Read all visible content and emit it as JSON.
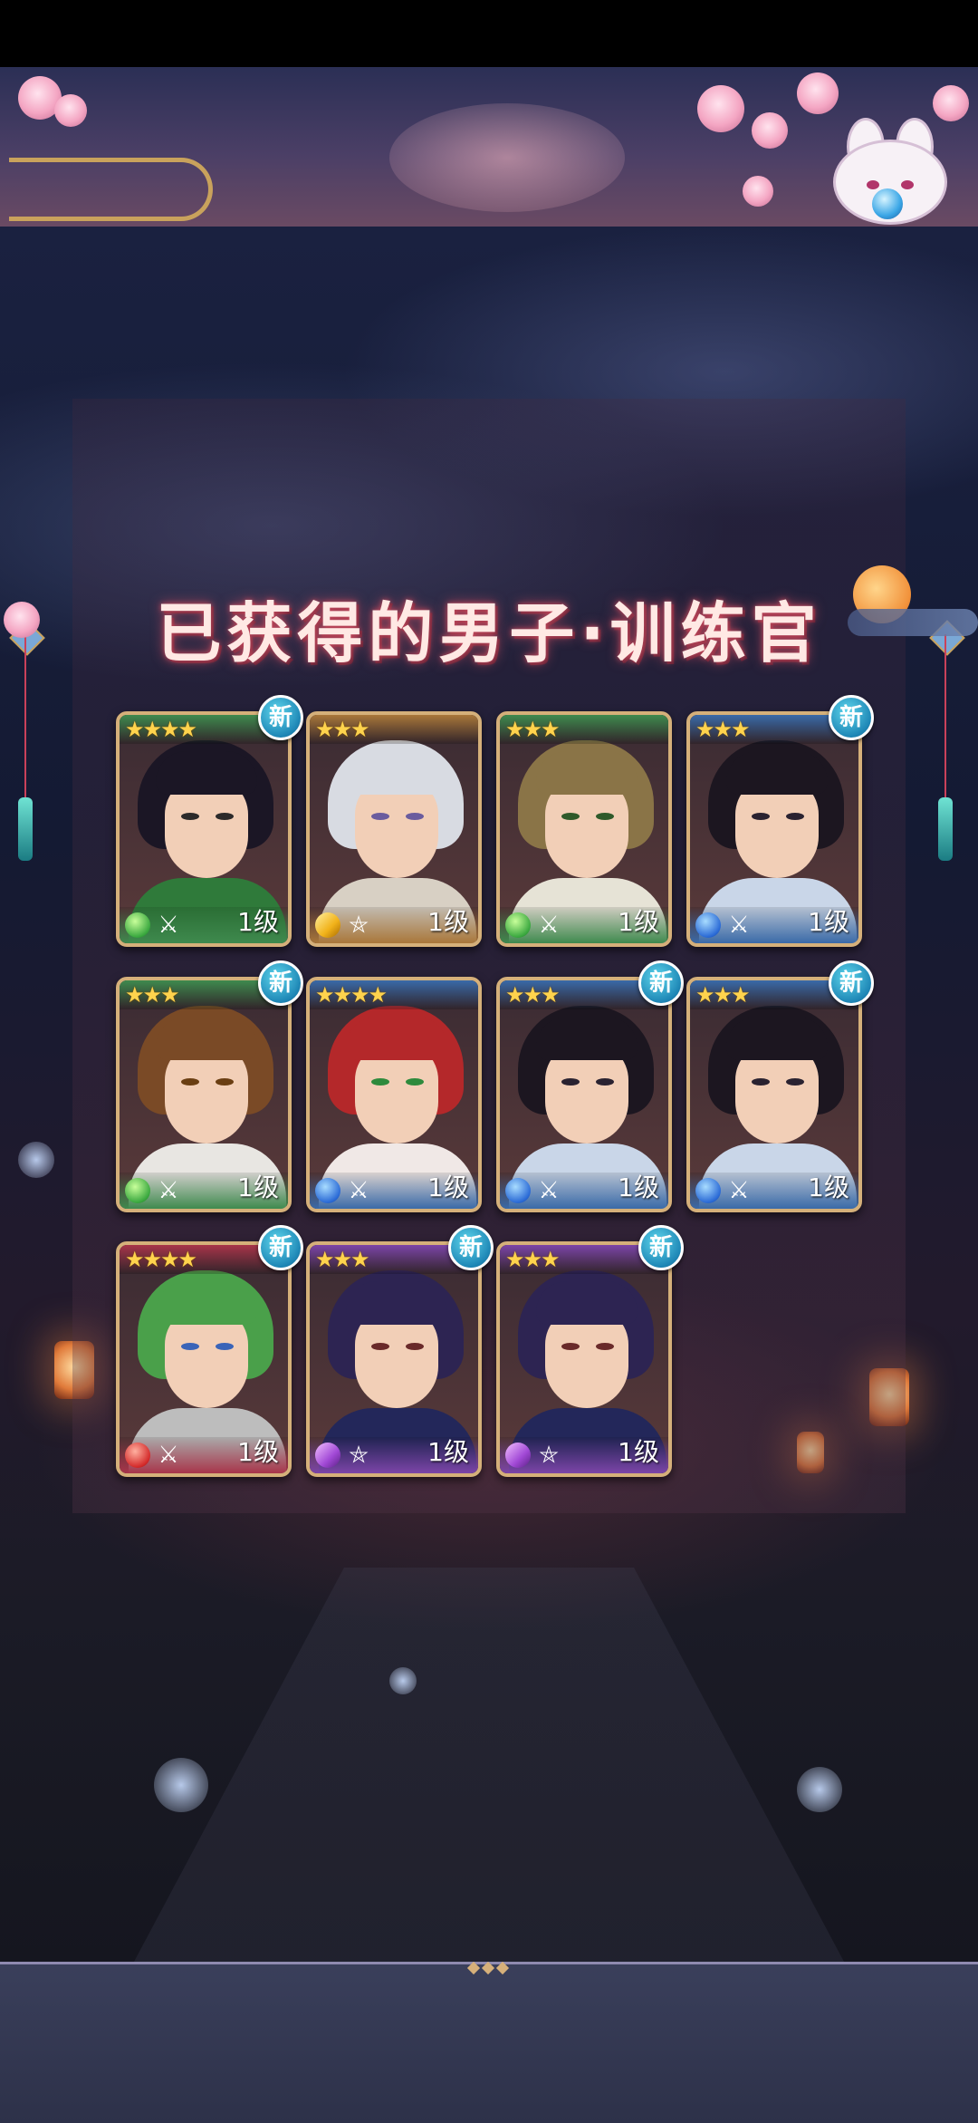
{
  "panel": {
    "title": "已获得的男子·训练官"
  },
  "new_badge_label": "新",
  "colors": {
    "accent_gold": "#d5b07a",
    "new_badge": "#1e87b6",
    "title_glow": "#c2475b"
  },
  "cards": [
    {
      "stars": "★★★★",
      "level": "1级",
      "is_new": true,
      "element_icon": "leaf-icon",
      "weapon_icon": "crossed-swords-icon",
      "band": "#3f8a4e",
      "hair": "#1b1625",
      "outfit": "#2f7a3a",
      "eyes": "#2c2a2a"
    },
    {
      "stars": "★★★",
      "level": "1级",
      "is_new": false,
      "element_icon": "diamond-icon",
      "weapon_icon": "pentagram-icon",
      "band": "#a9773a",
      "hair": "#d8dbe2",
      "outfit": "#d8d0c4",
      "eyes": "#6a5c9e"
    },
    {
      "stars": "★★★",
      "level": "1级",
      "is_new": false,
      "element_icon": "leaf-icon",
      "weapon_icon": "crossed-swords-icon",
      "band": "#3f8a4e",
      "hair": "#8a7447",
      "outfit": "#e6e3d6",
      "eyes": "#2f5a2a"
    },
    {
      "stars": "★★★",
      "level": "1级",
      "is_new": true,
      "element_icon": "water-icon",
      "weapon_icon": "crossed-swords-icon",
      "band": "#3a6aa8",
      "hair": "#1c1620",
      "outfit": "#c9d6e8",
      "eyes": "#2a2230"
    },
    {
      "stars": "★★★",
      "level": "1级",
      "is_new": true,
      "element_icon": "leaf-icon",
      "weapon_icon": "crossed-swords-icon",
      "band": "#3f8a4e",
      "hair": "#7a4a26",
      "outfit": "#e8e6e2",
      "eyes": "#6a3e12"
    },
    {
      "stars": "★★★★",
      "level": "1级",
      "is_new": false,
      "element_icon": "water-icon",
      "weapon_icon": "crossed-swords-icon",
      "band": "#3a6aa8",
      "hair": "#b4282a",
      "outfit": "#f0e8e6",
      "eyes": "#2e8a3c"
    },
    {
      "stars": "★★★",
      "level": "1级",
      "is_new": true,
      "element_icon": "water-icon",
      "weapon_icon": "crossed-swords-icon",
      "band": "#3a6aa8",
      "hair": "#1c1620",
      "outfit": "#c9d6e8",
      "eyes": "#2a2230"
    },
    {
      "stars": "★★★",
      "level": "1级",
      "is_new": true,
      "element_icon": "water-icon",
      "weapon_icon": "crossed-swords-icon",
      "band": "#3a6aa8",
      "hair": "#1c1620",
      "outfit": "#c9d6e8",
      "eyes": "#2a2230"
    },
    {
      "stars": "★★★★",
      "level": "1级",
      "is_new": true,
      "element_icon": "fire-icon",
      "weapon_icon": "crossed-swords-icon",
      "band": "#a8354a",
      "hair": "#4aa04a",
      "outfit": "#bdbdbd",
      "eyes": "#3a64b8"
    },
    {
      "stars": "★★★",
      "level": "1级",
      "is_new": true,
      "element_icon": "crystal-icon",
      "weapon_icon": "pentagram-icon",
      "band": "#7c45a8",
      "hair": "#2d2452",
      "outfit": "#23275a",
      "eyes": "#6a2a2a"
    },
    {
      "stars": "★★★",
      "level": "1级",
      "is_new": true,
      "element_icon": "crystal-icon",
      "weapon_icon": "pentagram-icon",
      "band": "#7c45a8",
      "hair": "#2d2452",
      "outfit": "#23275a",
      "eyes": "#6a2a2a"
    }
  ]
}
